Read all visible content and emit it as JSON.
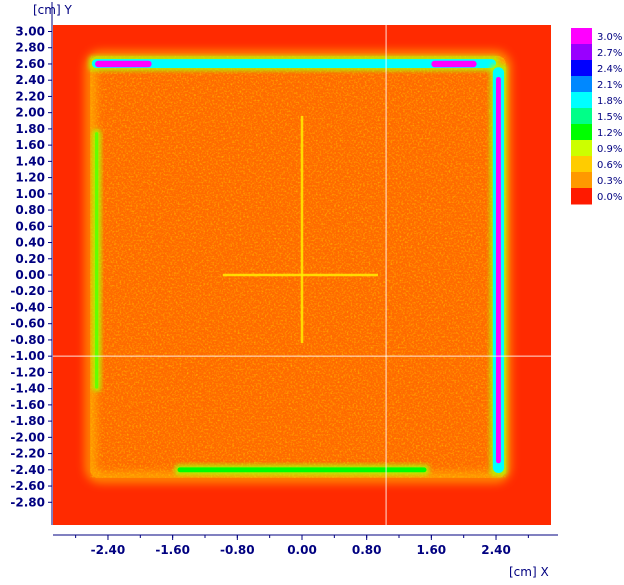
{
  "chart_data": {
    "type": "heatmap",
    "title": "",
    "xlabel": "[cm] X",
    "ylabel": "[cm] Y",
    "xlim": [
      -3.08,
      3.08
    ],
    "ylim": [
      -3.08,
      3.08
    ],
    "x_ticks": [
      "-2.40",
      "-1.60",
      "-0.80",
      "0.00",
      "0.80",
      "1.60",
      "2.40"
    ],
    "y_ticks": [
      "3.00",
      "2.80",
      "2.60",
      "2.40",
      "2.20",
      "2.00",
      "1.80",
      "1.60",
      "1.40",
      "1.20",
      "1.00",
      "0.80",
      "0.60",
      "0.40",
      "0.20",
      "0.00",
      "-0.20",
      "-0.40",
      "-0.60",
      "-0.80",
      "-1.00",
      "-1.20",
      "-1.40",
      "-1.60",
      "-1.80",
      "-2.00",
      "-2.20",
      "-2.40",
      "-2.60",
      "-2.80"
    ],
    "colorbar": {
      "labels": [
        "3.0%",
        "2.7%",
        "2.4%",
        "2.1%",
        "1.8%",
        "1.5%",
        "1.2%",
        "0.9%",
        "0.6%",
        "0.3%",
        "0.0%"
      ],
      "colors": [
        "#ff00ff",
        "#9900ff",
        "#0000ff",
        "#0088ff",
        "#00ffff",
        "#00ff88",
        "#00ff00",
        "#ccff00",
        "#ffcc00",
        "#ff9900",
        "#ff1a00"
      ]
    },
    "crosshair": {
      "x": 1.04,
      "y": -1.0
    },
    "features": [
      {
        "name": "top-bar",
        "x": [
          -2.6,
          2.4
        ],
        "y": [
          2.55,
          2.66
        ],
        "value": "1.8%"
      },
      {
        "name": "top-bar-left-end",
        "x": [
          -2.56,
          -1.86
        ],
        "y": [
          2.56,
          2.64
        ],
        "value": "3.0%"
      },
      {
        "name": "top-bar-right-end",
        "x": [
          1.6,
          2.16
        ],
        "y": [
          2.56,
          2.64
        ],
        "value": "3.0%"
      },
      {
        "name": "right-bar",
        "x": [
          2.36,
          2.5
        ],
        "y": [
          -2.44,
          2.56
        ],
        "value": "1.8%"
      },
      {
        "name": "right-bar-core",
        "x": [
          2.4,
          2.46
        ],
        "y": [
          -2.32,
          2.44
        ],
        "value": "3.0%"
      },
      {
        "name": "bottom-bar",
        "x": [
          -1.54,
          1.54
        ],
        "y": [
          -2.43,
          -2.37
        ],
        "value": "1.2%"
      },
      {
        "name": "left-line",
        "x": [
          -2.56,
          -2.52
        ],
        "y": [
          -1.4,
          1.76
        ],
        "value": "1.0%"
      },
      {
        "name": "center-cross-horizontal",
        "x": [
          -0.98,
          0.94
        ],
        "y": [
          0.0,
          0.0
        ],
        "value": "0.6%"
      },
      {
        "name": "center-cross-vertical",
        "x": [
          0.0,
          0.0
        ],
        "y": [
          -0.84,
          1.96
        ],
        "value": "0.6%"
      }
    ]
  }
}
